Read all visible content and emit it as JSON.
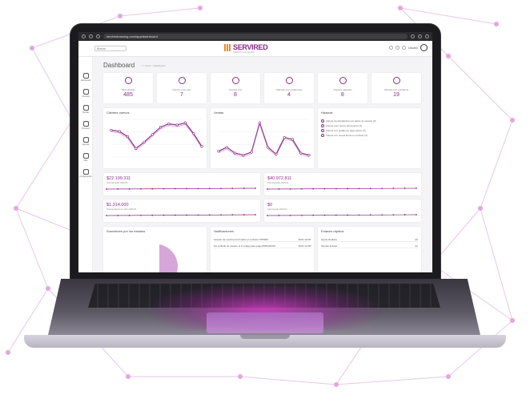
{
  "browser": {
    "url": "servirednaming.com/app/dashboard"
  },
  "app": {
    "search_placeholder": "Buscar",
    "logo_text": "SERVIRED",
    "logo_sub": "Plataforma de gestión",
    "logo_badge": "Going",
    "user_name": "Usuario"
  },
  "sidebar": {
    "items": [
      {
        "label": "Dashboard",
        "icon": "home-icon"
      },
      {
        "label": "Usuarios",
        "icon": "users-icon"
      },
      {
        "label": "Tiendas",
        "icon": "store-icon"
      },
      {
        "label": "Procesos",
        "icon": "process-icon"
      },
      {
        "label": "Agenda",
        "icon": "calendar-icon"
      },
      {
        "label": "Más",
        "icon": "more-icon"
      },
      {
        "label": "Configuración",
        "icon": "gear-icon"
      }
    ]
  },
  "page": {
    "title": "Dashboard",
    "breadcrumb": "> > Inicio > Dashboard"
  },
  "kpis": [
    {
      "label": "Total clientes",
      "value": "485",
      "icon": "users-icon"
    },
    {
      "label": "Nuevos este mes",
      "value": "7",
      "icon": "user-icon"
    },
    {
      "label": "Nuevos hoy",
      "value": "8",
      "icon": "user-add-icon"
    },
    {
      "label": "Clientes con incidencias",
      "value": "4",
      "icon": "award-icon"
    },
    {
      "label": "Clientes pagados",
      "value": "8",
      "icon": "badge-icon"
    },
    {
      "label": "Clientes con pendiente",
      "value": "19",
      "icon": "warning-icon"
    }
  ],
  "charts": {
    "left_title": "Clientes nuevos",
    "mid_title": "Ventas",
    "right_title": "Historial",
    "history": [
      "Cliente ha actualizado sus datos de usuario (3)",
      "Cliente creó nuevo documento (1)",
      "Cliente con pedido de pago activo (3)",
      "Cliente con nueva firma en contrato (3)"
    ]
  },
  "amounts": [
    {
      "value": "$22.199.311",
      "label": "Total facturado 2020-04"
    },
    {
      "value": "$40.972.811",
      "label": "Total esperado 2020-04"
    },
    {
      "value": "$1.314.000",
      "label": "Total pendiente de cobro 2020-04"
    },
    {
      "value": "$0",
      "label": "Total vencido 2020-04"
    }
  ],
  "bottom": {
    "distribution_title": "Suscritores por los estados",
    "notifications_title": "Notificaciones",
    "notifications": [
      {
        "text": "Usuario de nombre ha firmado el contrato 7783456",
        "date": "2021-12-08"
      },
      {
        "text": "Ha recibido de usuario el 2 codigo para pago 8953432341",
        "date": "2021-12-08"
      }
    ],
    "links_title": "Enlaces rápidos",
    "links": [
      {
        "label": "Ajuste Pedidos",
        "count": "(0)"
      },
      {
        "label": "Ofertas activas",
        "count": "(0)"
      }
    ]
  },
  "chart_data": [
    {
      "type": "line",
      "title": "Clientes nuevos",
      "values": [
        25,
        24,
        19,
        8,
        14,
        21,
        28,
        31,
        30,
        32,
        22,
        10
      ]
    },
    {
      "type": "line",
      "title": "Ventas",
      "values": [
        6,
        10,
        4,
        2,
        5,
        35,
        10,
        3,
        20,
        18,
        4,
        2
      ]
    }
  ],
  "colors": {
    "accent": "#8a2b86",
    "secondary": "#d27ad0"
  }
}
